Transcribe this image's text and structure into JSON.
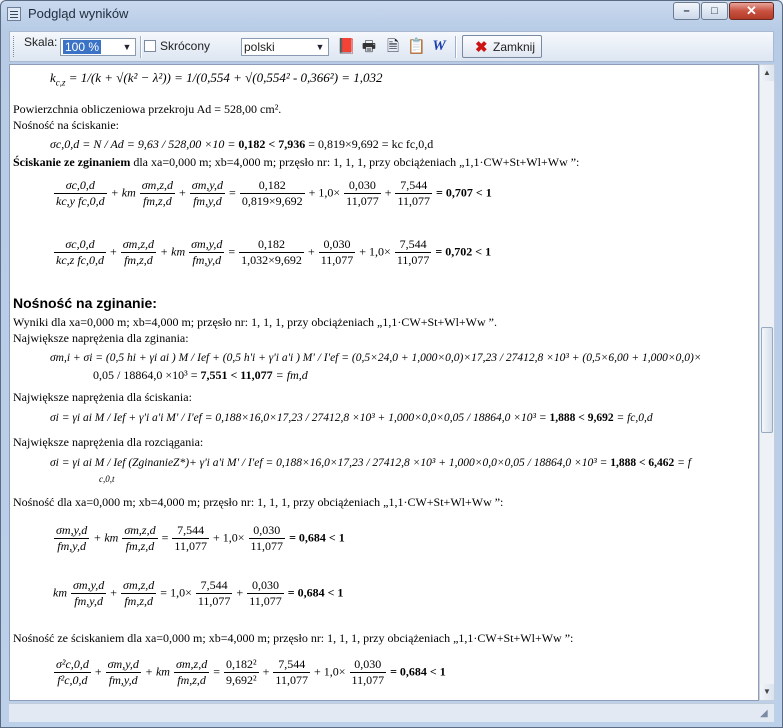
{
  "window": {
    "title": "Podgląd wyników",
    "minimize_glyph": "–",
    "maximize_glyph": "□",
    "close_glyph": "✕"
  },
  "toolbar": {
    "scale_label": "Skala:",
    "scale_value": "100 %",
    "compact_label": "Skrócony",
    "compact_checked": false,
    "language_value": "polski",
    "icons": [
      "book-icon",
      "printer-icon",
      "document-icon",
      "clipboard-icon",
      "word-icon"
    ],
    "close_label": "Zamknij",
    "close_icon": "red-x-icon"
  },
  "report": {
    "k_formula_prefix": "k",
    "k_formula_line": "= 1/(k + √(k² − λ²)) = 1/(0,554 + √(0,554² - 0,366²) = 1,032",
    "area_line": "Powierzchnia obliczeniowa przekroju  Ad = 528,00 cm².",
    "nosnosc_scisk": "Nośność na ściskanie:",
    "sigma_c_line_a": "σc,0,d = N / Ad = 9,63 / 528,00 ×10 = ",
    "sigma_c_line_b": "0,182 < 7,936",
    "sigma_c_line_c": " = 0,819×9,692 = kc fc,0,d",
    "scisk_zgin_bold": "Ściskanie ze zginaniem",
    "scisk_zgin_rest": " dla  xa=0,000 m; xb=4,000 m; przęsło nr: 1, 1, 1, przy obciążeniach „1,1·CW+St+Wl+Ww ”:",
    "eq1": {
      "t1_num": "σc,0,d",
      "t1_den": "kc,y fc,0,d",
      "km": "+ km",
      "t2_num": "σm,z,d",
      "t2_den": "fm,z,d",
      "t3_num": "σm,y,d",
      "t3_den": "fm,y,d",
      "eq": "=",
      "v1_num": "0,182",
      "v1_den": "0,819×9,692",
      "plus_km": "+ 1,0×",
      "v2_num": "0,030",
      "v2_den": "11,077",
      "v3_num": "7,544",
      "v3_den": "11,077",
      "result": "= 0,707 < 1"
    },
    "eq2": {
      "t1_num": "σc,0,d",
      "t1_den": "kc,z fc,0,d",
      "t2_num": "σm,z,d",
      "t2_den": "fm,z,d",
      "km": "+ km",
      "t3_num": "σm,y,d",
      "t3_den": "fm,y,d",
      "v1_num": "0,182",
      "v1_den": "1,032×9,692",
      "v2_num": "0,030",
      "v2_den": "11,077",
      "plus_km": "+ 1,0×",
      "v3_num": "7,544",
      "v3_den": "11,077",
      "result": "= 0,702 < 1"
    },
    "heading_zginanie": "Nośność na zginanie:",
    "wyniki_line": "Wyniki dla  xa=0,000 m; xb=4,000 m; przęsło nr: 1, 1, 1, przy obciążeniach „1,1·CW+St+Wl+Ww ”.",
    "max_zgin_label": "Największe naprężenia dla zginania:",
    "sigma_m_line1": "σm,i + σi = (0,5 hi + γi ai ) M / Ief + (0,5 h'i + γ'i a'i ) M' / I'ef = (0,5×24,0 + 1,000×0,0)×17,23 / 27412,8 ×10³ + (0,5×6,00 + 1,000×0,0)×",
    "sigma_m_line2a": "0,05 / 18864,0 ×10³ = ",
    "sigma_m_line2b": "7,551 < 11,077",
    "sigma_m_line2c": " = fm,d",
    "max_scisk_label": "Największe naprężenia dla ściskania:",
    "sigma_i_scisk_a": "σi = γi ai M / Ief + γ'i a'i M' / I'ef = 0,188×16,0×17,23 / 27412,8 ×10³ + 1,000×0,0×0,05 / 18864,0 ×10³ = ",
    "sigma_i_scisk_b": "1,888 < 9,692",
    "sigma_i_scisk_c": " = fc,0,d",
    "max_rozc_label": "Największe naprężenia dla rozciągania:",
    "sigma_i_rozc_a": "σi = γi ai M / Ief (ZginanieZ*)+ γ'i a'i M' / I'ef = 0,188×16,0×17,23 / 27412,8 ×10³ + 1,000×0,0×0,05 / 18864,0 ×10³ = ",
    "sigma_i_rozc_b": "1,888 < 6,462",
    "sigma_i_rozc_c": " = f",
    "sigma_i_rozc_sub": "c,0,t",
    "nosnosc_dla_line": "Nośność  dla  xa=0,000 m; xb=4,000 m; przęsło nr: 1, 1, 1, przy obciążeniach „1,1·CW+St+Wl+Ww ”:",
    "eq3": {
      "t1_num": "σm,y,d",
      "t1_den": "fm,y,d",
      "km": "+ km",
      "t2_num": "σm,z,d",
      "t2_den": "fm,z,d",
      "v1_num": "7,544",
      "v1_den": "11,077",
      "plus": "+ 1,0×",
      "v2_num": "0,030",
      "v2_den": "11,077",
      "result": "= 0,684 < 1"
    },
    "eq4": {
      "km": "km",
      "t1_num": "σm,y,d",
      "t1_den": "fm,y,d",
      "t2_num": "σm,z,d",
      "t2_den": "fm,z,d",
      "eq_coef": "= 1,0×",
      "v1_num": "7,544",
      "v1_den": "11,077",
      "v2_num": "0,030",
      "v2_den": "11,077",
      "result": "= 0,684 < 1"
    },
    "nosnosc_scisk_line": "Nośność ze ściskaniem dla  xa=0,000 m; xb=4,000 m; przęsło nr: 1, 1, 1, przy obciążeniach „1,1·CW+St+Wl+Ww ”:",
    "eq5": {
      "t1_num": "σ²c,0,d",
      "t1_den": "f²c,0,d",
      "t2_num": "σm,y,d",
      "t2_den": "fm,y,d",
      "km": "+ km",
      "t3_num": "σm,z,d",
      "t3_den": "fm,z,d",
      "v1_num": "0,182²",
      "v1_den": "9,692²",
      "v2_num": "7,544",
      "v2_den": "11,077",
      "plus": "+ 1,0×",
      "v3_num": "0,030",
      "v3_den": "11,077",
      "result": "= 0,684 < 1"
    }
  }
}
